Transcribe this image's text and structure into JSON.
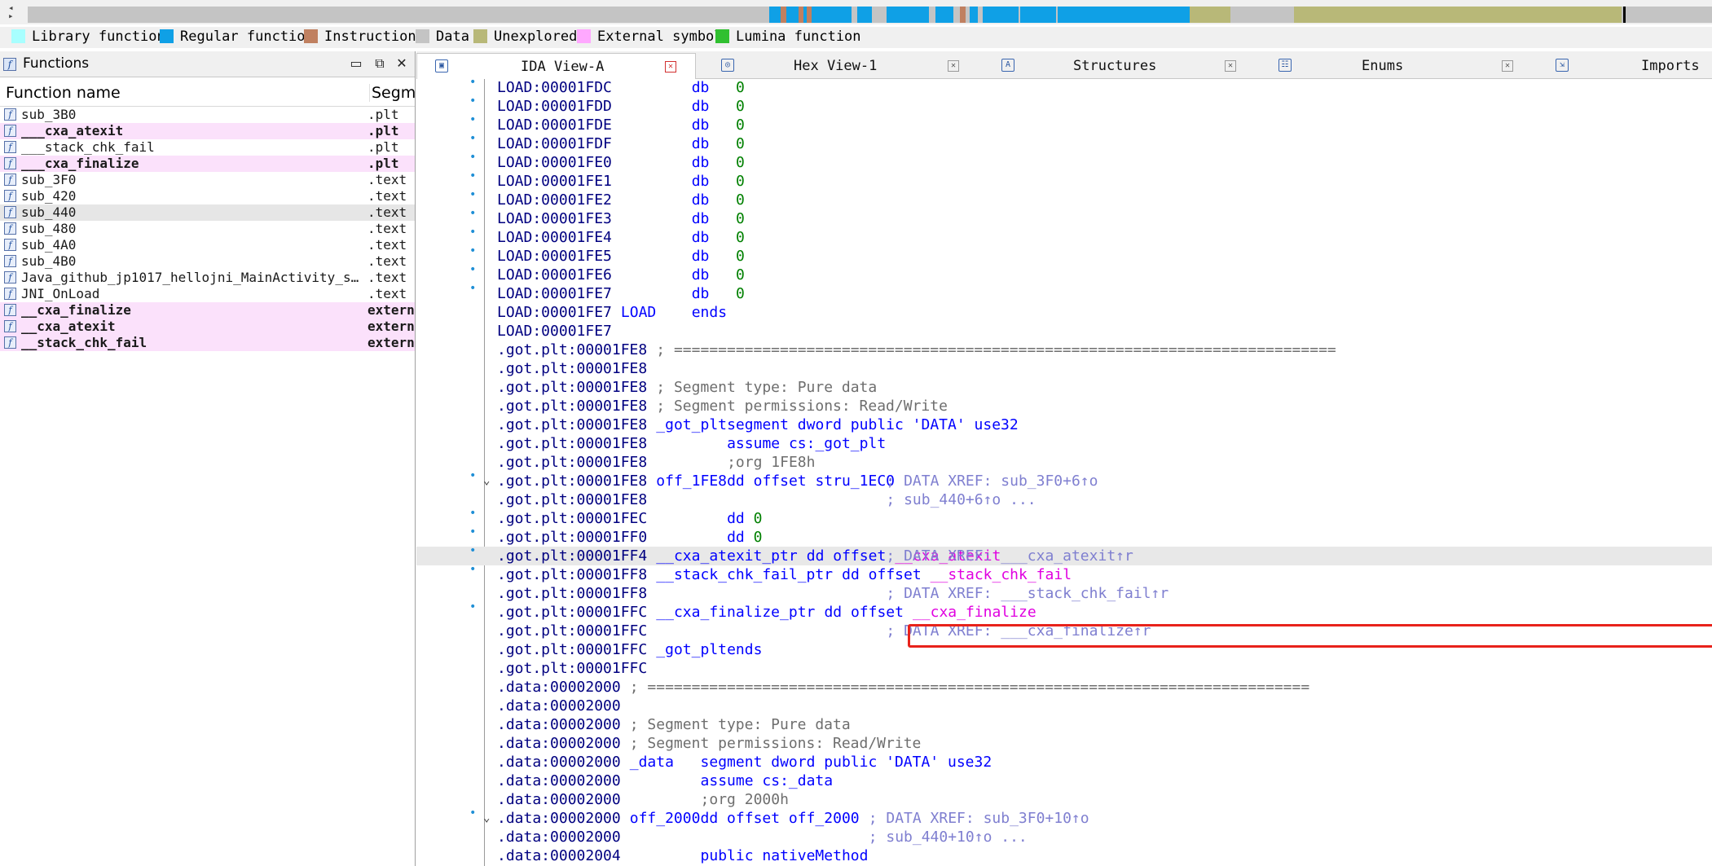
{
  "colors": {
    "library_function": "#a8ffff",
    "regular_function": "#0fa0e6",
    "instruction": "#c08060",
    "data": "#c4c4c4",
    "unexplored": "#b8b878",
    "external_symbol": "#ffa8ff",
    "lumina_function": "#30c030",
    "highlight_border": "#e8221b"
  },
  "legend": [
    {
      "label": "Library function",
      "color": "#a8ffff"
    },
    {
      "label": "Regular function",
      "color": "#0fa0e6"
    },
    {
      "label": "Instruction",
      "color": "#c08060"
    },
    {
      "label": "Data",
      "color": "#c4c4c4"
    },
    {
      "label": "Unexplored",
      "color": "#b8b878"
    },
    {
      "label": "External symbol",
      "color": "#ffa8ff"
    },
    {
      "label": "Lumina function",
      "color": "#30c030"
    }
  ],
  "functions_panel": {
    "title": "Functions",
    "col_name": "Function name",
    "col_segment": "Segme",
    "rows": [
      {
        "name": "sub_3B0",
        "segment": ".plt"
      },
      {
        "name": "___cxa_atexit",
        "segment": ".plt"
      },
      {
        "name": "___stack_chk_fail",
        "segment": ".plt"
      },
      {
        "name": "___cxa_finalize",
        "segment": ".plt"
      },
      {
        "name": "sub_3F0",
        "segment": ".text"
      },
      {
        "name": "sub_420",
        "segment": ".text"
      },
      {
        "name": "sub_440",
        "segment": ".text"
      },
      {
        "name": "sub_480",
        "segment": ".text"
      },
      {
        "name": "sub_4A0",
        "segment": ".text"
      },
      {
        "name": "sub_4B0",
        "segment": ".text"
      },
      {
        "name": "Java_github_jp1017_hellojni_MainActivity_sta⋯",
        "segment": ".text"
      },
      {
        "name": "JNI_OnLoad",
        "segment": ".text"
      },
      {
        "name": "__cxa_finalize",
        "segment": "extern"
      },
      {
        "name": "__cxa_atexit",
        "segment": "extern"
      },
      {
        "name": "__stack_chk_fail",
        "segment": "extern"
      }
    ]
  },
  "tabs": [
    {
      "label": "IDA View-A",
      "icon": "ida-view-icon",
      "active": true
    },
    {
      "label": "Hex View-1",
      "icon": "hex-view-icon",
      "active": false
    },
    {
      "label": "Structures",
      "icon": "structures-icon",
      "active": false
    },
    {
      "label": "Enums",
      "icon": "enums-icon",
      "active": false
    },
    {
      "label": "Imports",
      "icon": "imports-icon",
      "active": false
    }
  ],
  "code": [
    {
      "addr": "LOAD:00001FDC",
      "op": "db",
      "val": "0"
    },
    {
      "addr": "LOAD:00001FDD",
      "op": "db",
      "val": "0"
    },
    {
      "addr": "LOAD:00001FDE",
      "op": "db",
      "val": "0"
    },
    {
      "addr": "LOAD:00001FDF",
      "op": "db",
      "val": "0"
    },
    {
      "addr": "LOAD:00001FE0",
      "op": "db",
      "val": "0"
    },
    {
      "addr": "LOAD:00001FE1",
      "op": "db",
      "val": "0"
    },
    {
      "addr": "LOAD:00001FE2",
      "op": "db",
      "val": "0"
    },
    {
      "addr": "LOAD:00001FE3",
      "op": "db",
      "val": "0"
    },
    {
      "addr": "LOAD:00001FE4",
      "op": "db",
      "val": "0"
    },
    {
      "addr": "LOAD:00001FE5",
      "op": "db",
      "val": "0"
    },
    {
      "addr": "LOAD:00001FE6",
      "op": "db",
      "val": "0"
    },
    {
      "addr": "LOAD:00001FE7",
      "op": "db",
      "val": "0"
    },
    {
      "addr": "LOAD:00001FE7",
      "label": "LOAD",
      "op": "ends"
    },
    {
      "addr": "LOAD:00001FE7"
    },
    {
      "addr": ".got.plt:00001FE8",
      "comment": "; ==========================================================================="
    },
    {
      "addr": ".got.plt:00001FE8"
    },
    {
      "addr": ".got.plt:00001FE8",
      "comment": "; Segment type: Pure data"
    },
    {
      "addr": ".got.plt:00001FE8",
      "comment": "; Segment permissions: Read/Write"
    },
    {
      "addr": ".got.plt:00001FE8",
      "label": "_got_plt",
      "op": "segment dword public 'DATA' use32"
    },
    {
      "addr": ".got.plt:00001FE8",
      "op": "assume cs:_got_plt"
    },
    {
      "addr": ".got.plt:00001FE8",
      "op": ";org 1FE8h"
    },
    {
      "addr": ".got.plt:00001FE8",
      "label": "off_1FE8",
      "op": "dd offset stru_1EC0",
      "xref": "; DATA XREF: sub_3F0+6↑o"
    },
    {
      "addr": ".got.plt:00001FE8",
      "xref": "; sub_440+6↑o ..."
    },
    {
      "addr": ".got.plt:00001FEC",
      "op": "dd",
      "val": "0"
    },
    {
      "addr": ".got.plt:00001FF0",
      "op": "dd",
      "val": "0"
    },
    {
      "addr": ".got.plt:00001FF4",
      "label": "__cxa_atexit_ptr",
      "op": "dd offset",
      "target": "__cxa_atexit",
      "xref": "; DATA XREF: ___cxa_atexit↑r"
    },
    {
      "addr": ".got.plt:00001FF8",
      "label": "__stack_chk_fail_ptr",
      "op": "dd offset",
      "target": "__stack_chk_fail"
    },
    {
      "addr": ".got.plt:00001FF8",
      "xref": "; DATA XREF: ___stack_chk_fail↑r"
    },
    {
      "addr": ".got.plt:00001FFC",
      "label": "__cxa_finalize_ptr",
      "op": "dd offset",
      "target": "__cxa_finalize"
    },
    {
      "addr": ".got.plt:00001FFC",
      "xref": "; DATA XREF: ___cxa_finalize↑r"
    },
    {
      "addr": ".got.plt:00001FFC",
      "label": "_got_plt",
      "op": "ends"
    },
    {
      "addr": ".got.plt:00001FFC"
    },
    {
      "addr": ".data:00002000",
      "comment": "; ==========================================================================="
    },
    {
      "addr": ".data:00002000"
    },
    {
      "addr": ".data:00002000",
      "comment": "; Segment type: Pure data"
    },
    {
      "addr": ".data:00002000",
      "comment": "; Segment permissions: Read/Write"
    },
    {
      "addr": ".data:00002000",
      "label": "_data",
      "op": "segment dword public 'DATA' use32"
    },
    {
      "addr": ".data:00002000",
      "op": "assume cs:_data"
    },
    {
      "addr": ".data:00002000",
      "op": ";org 2000h"
    },
    {
      "addr": ".data:00002000",
      "label": "off_2000",
      "op": "dd offset off_2000",
      "xref": "; DATA XREF: sub_3F0+10↑o"
    },
    {
      "addr": ".data:00002000",
      "xref": "; sub_440+10↑o ..."
    },
    {
      "addr": ".data:00002004",
      "op": "public nativeMethod"
    }
  ]
}
